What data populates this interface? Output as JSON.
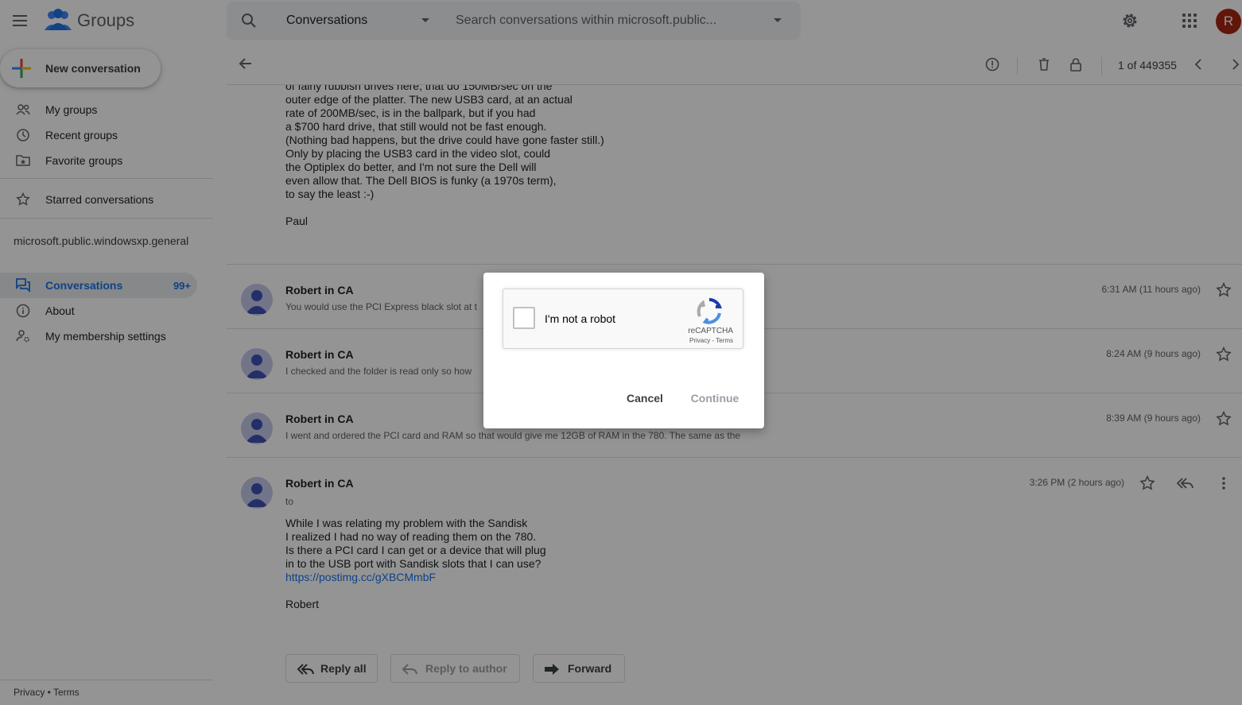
{
  "header": {
    "app_name": "Groups",
    "search_scope": "Conversations",
    "search_placeholder": "Search conversations within microsoft.public...",
    "avatar_initial": "R"
  },
  "sidebar": {
    "new_conversation": "New conversation",
    "items": [
      {
        "label": "My groups",
        "icon": "people-icon"
      },
      {
        "label": "Recent groups",
        "icon": "clock-icon"
      },
      {
        "label": "Favorite groups",
        "icon": "folder-star-icon"
      },
      {
        "label": "Starred conversations",
        "icon": "star-icon"
      }
    ],
    "group_name": "microsoft.public.windowsxp.general",
    "group_items": [
      {
        "label": "Conversations",
        "count": "99+",
        "icon": "forum-icon"
      },
      {
        "label": "About",
        "icon": "info-icon"
      },
      {
        "label": "My membership settings",
        "icon": "person-settings-icon"
      }
    ],
    "footer": "Privacy • Terms"
  },
  "toolbar": {
    "pager": "1 of 449355"
  },
  "thread": {
    "top_body": "of fairly rubbish drives here, that do 150MB/sec on the\nouter edge of the platter. The new USB3 card, at an actual\nrate of 200MB/sec, is in the ballpark, but if you had\na $700 hard drive, that still would not be fast enough.\n(Nothing bad happens, but the drive could have gone faster still.)\nOnly by placing the USB3 card in the video slot, could\nthe Optiplex do better, and I'm not sure the Dell will\neven allow that. The Dell BIOS is funky (a 1970s term),\nto say the least :-)\n\nPaul",
    "messages": [
      {
        "author": "Robert in CA",
        "snippet": "You would use the PCI Express black slot at t",
        "time": "6:31 AM (11 hours ago)"
      },
      {
        "author": "Robert in CA",
        "snippet": "I checked and the folder is read only so how",
        "time": "8:24 AM (9 hours ago)"
      },
      {
        "author": "Robert in CA",
        "snippet": "I went and ordered the PCI card and RAM so that would give me 12GB of RAM in the 780. The same as the",
        "time": "8:39 AM (9 hours ago)"
      }
    ],
    "expanded": {
      "author": "Robert in CA",
      "to": "to",
      "time": "3:26 PM (2 hours ago)",
      "body": "While I was relating my problem with the Sandisk\nI realized I had no way of reading them on the 780.\nIs there a PCI card I can get or a device that will plug\nin to the USB port with Sandisk slots that I can use?",
      "link": "https://postimg.cc/gXBCMmbF",
      "signature": "Robert"
    },
    "actions": {
      "reply_all": "Reply all",
      "reply_author": "Reply to author",
      "forward": "Forward"
    }
  },
  "dialog": {
    "captcha_label": "I'm not a robot",
    "captcha_brand": "reCAPTCHA",
    "captcha_links": "Privacy - Terms",
    "cancel": "Cancel",
    "continue": "Continue"
  }
}
